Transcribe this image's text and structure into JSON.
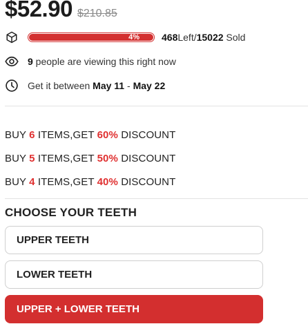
{
  "pricing": {
    "price": "$52.90",
    "old_price": "$210.85"
  },
  "stock": {
    "percent": 0.04,
    "percent_label": "4%",
    "left_count": "468",
    "left_label": "Left",
    "separator": " /",
    "sold_count": "15022",
    "sold_label": " Sold"
  },
  "viewers": {
    "count": "9",
    "text": " people are viewing this right now"
  },
  "shipping": {
    "prefix": "Get it between ",
    "start": "May 11",
    "sep": " - ",
    "end": "May 22"
  },
  "discounts": [
    {
      "pre": "BUY ",
      "qty": "6",
      "mid": " ITEMS,GET ",
      "pct": "60%",
      "post": " DISCOUNT"
    },
    {
      "pre": "BUY ",
      "qty": "5",
      "mid": " ITEMS,GET ",
      "pct": "50%",
      "post": " DISCOUNT"
    },
    {
      "pre": "BUY ",
      "qty": "4",
      "mid": " ITEMS,GET ",
      "pct": "40%",
      "post": " DISCOUNT"
    }
  ],
  "teeth": {
    "heading": "CHOOSE YOUR TEETH",
    "options": [
      "UPPER TEETH",
      "LOWER TEETH",
      "UPPER + LOWER TEETH"
    ],
    "selected": "UPPER + LOWER TEETH"
  },
  "icons": {
    "stock": "box-icon",
    "viewers": "eye-icon",
    "shipping": "clock-icon"
  },
  "colors": {
    "accent": "#d32f2f",
    "discount_highlight": "#e03131"
  }
}
